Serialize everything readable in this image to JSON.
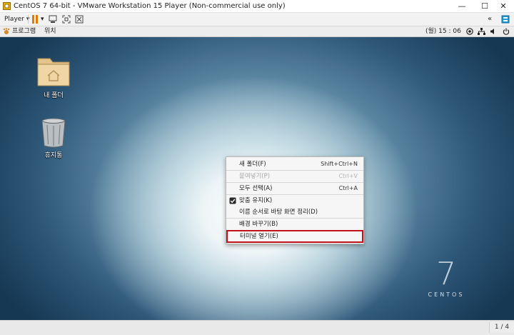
{
  "window": {
    "title": "CentOS 7 64-bit - VMware Workstation 15 Player (Non-commercial use only)",
    "minimize_glyph": "—",
    "maximize_glyph": "☐",
    "close_glyph": "✕"
  },
  "toolbar": {
    "player_label": "Player",
    "player_caret": "▾",
    "pause_caret": "▾",
    "collapse_label": "«"
  },
  "gnome_bar": {
    "programs_label": "프로그램",
    "places_label": "위치",
    "clock": "(월) 15 : 06"
  },
  "desktop": {
    "icons": [
      {
        "label": "내 폴더",
        "icon": "home-folder-icon"
      },
      {
        "label": "휴지통",
        "icon": "trash-icon"
      }
    ],
    "logo": {
      "number": "7",
      "word": "CENTOS"
    }
  },
  "context_menu": {
    "items": [
      {
        "label": "새 폴더(F)",
        "shortcut": "Shift+Ctrl+N",
        "enabled": true
      },
      {
        "label": "붙여넣기(P)",
        "shortcut": "Ctrl+V",
        "enabled": false
      },
      {
        "label": "모두 선택(A)",
        "shortcut": "Ctrl+A",
        "enabled": true
      },
      {
        "label": "맞춤 유지(K)",
        "shortcut": "",
        "enabled": true,
        "checked": true
      },
      {
        "label": "이름 순서로 바탕 화면 정리(D)",
        "shortcut": "",
        "enabled": true
      },
      {
        "label": "배경 바꾸기(B)",
        "shortcut": "",
        "enabled": true
      },
      {
        "label": "터미널 열기(E)",
        "shortcut": "",
        "enabled": true,
        "highlighted": true
      }
    ]
  },
  "statusbar": {
    "page_indicator": "1 / 4"
  },
  "colors": {
    "highlight_outline": "#c0121b",
    "pause_icon": "#e07b00",
    "desktop_dark": "#163853",
    "desktop_light": "#ffffff"
  }
}
